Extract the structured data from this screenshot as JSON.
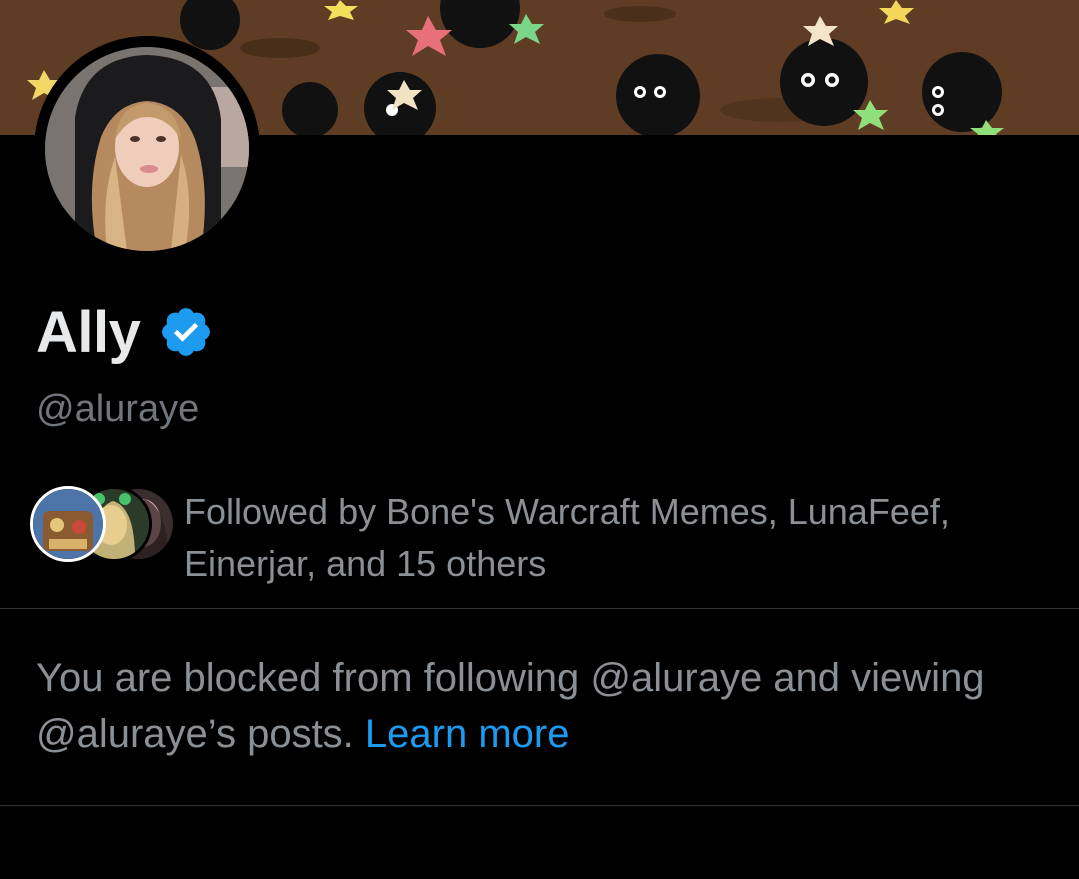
{
  "profile": {
    "display_name": "Ally",
    "handle": "@aluraye",
    "verified_icon": "verified-badge-icon",
    "verified_color": "#1d9bf0"
  },
  "followers": {
    "text": "Followed by Bone's Warcraft Memes, LunaFeef, Einerjar, and 15 others"
  },
  "notice": {
    "blocked_text": "You are blocked from following @aluraye and viewing @aluraye’s posts.",
    "link_text": "Learn more",
    "link_color": "#1d9bf0"
  },
  "theme": {
    "background": "#000000",
    "primary_text": "#e7e9ea",
    "secondary_text": "#71767b",
    "divider": "#2f3336"
  }
}
